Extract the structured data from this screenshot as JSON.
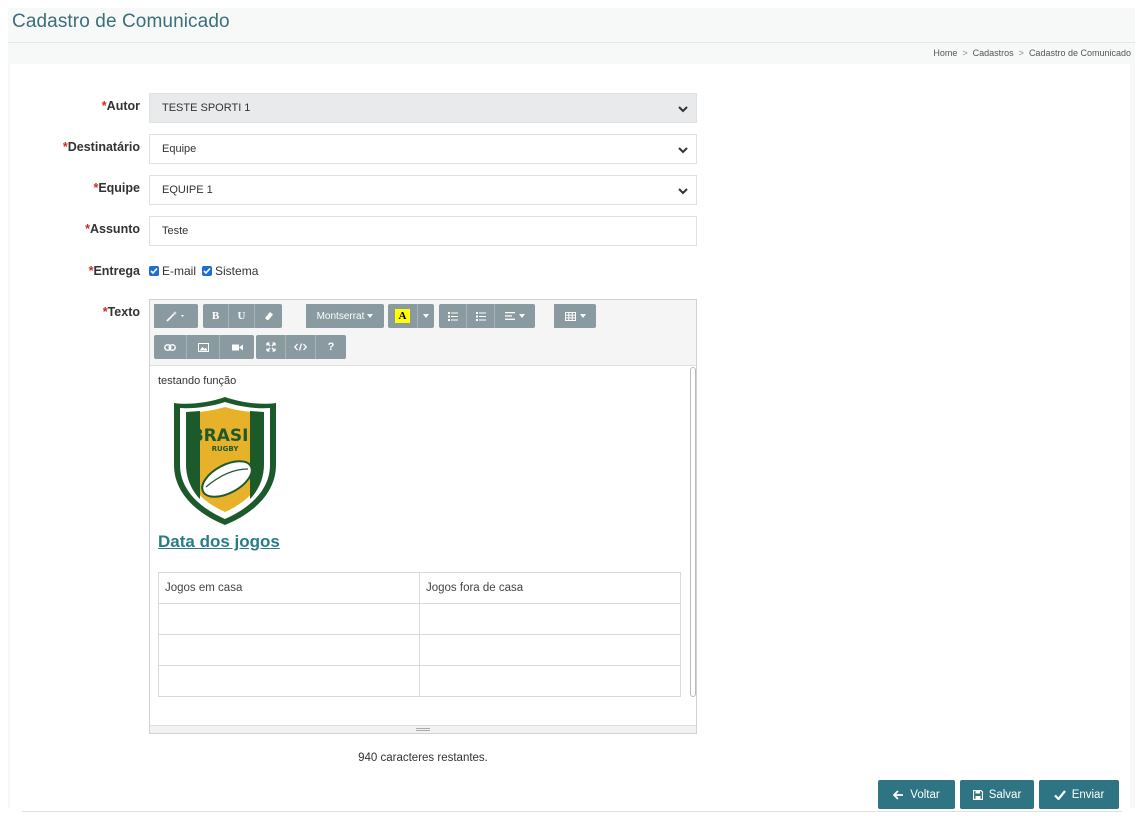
{
  "page": {
    "title": "Cadastro de Comunicado"
  },
  "breadcrumb": {
    "items": [
      "Home",
      "Cadastros",
      "Cadastro de Comunicado"
    ],
    "separator": ">"
  },
  "form": {
    "required_mark": "*",
    "autor": {
      "label": "Autor",
      "value": "TESTE SPORTI 1"
    },
    "destinatario": {
      "label": "Destinatário",
      "value": "Equipe"
    },
    "equipe": {
      "label": "Equipe",
      "value": "EQUIPE 1"
    },
    "assunto": {
      "label": "Assunto",
      "value": "Teste"
    },
    "entrega": {
      "label": "Entrega",
      "options": [
        {
          "label": "E-mail",
          "checked": true
        },
        {
          "label": "Sistema",
          "checked": true
        }
      ]
    },
    "texto": {
      "label": "Texto"
    }
  },
  "editor": {
    "toolbar": {
      "font_name": "Montserrat",
      "highlight_letter": "A",
      "bold": "B",
      "underline": "U",
      "help": "?"
    },
    "content": {
      "paragraph": "testando função",
      "logo_text_1": "BRASIL",
      "logo_text_2": "RUGBY",
      "heading": "Data dos jogos",
      "table_headers": [
        "Jogos em casa",
        "Jogos fora de casa"
      ],
      "empty_rows": 3
    }
  },
  "counter_text": "940 caracteres restantes.",
  "actions": {
    "back": "Voltar",
    "save": "Salvar",
    "send": "Enviar"
  },
  "colors": {
    "accent": "#2e7482",
    "title": "#3a6f7c",
    "required": "#d9241b",
    "heading": "#2a7b8a",
    "checkbox": "#1f6fd1",
    "toolbar_button": "#8a9aa1"
  }
}
